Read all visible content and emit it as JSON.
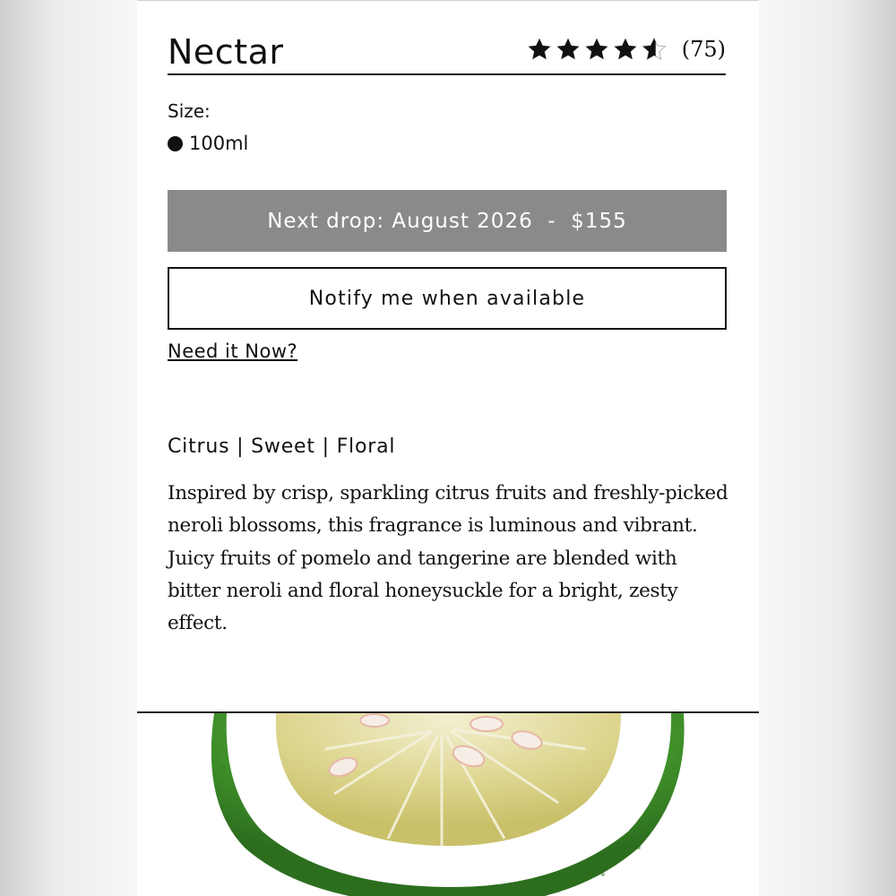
{
  "product": {
    "title": "Nectar",
    "rating": 4.5,
    "review_count": "(75)"
  },
  "size": {
    "label": "Size:",
    "selected": "100ml"
  },
  "actions": {
    "drop_label": "Next drop: August 2026  -  $155",
    "notify_label": "Notify me when available",
    "need_it_now": "Need it Now?"
  },
  "details": {
    "notes": "Citrus | Sweet | Floral",
    "description": "Inspired by crisp, sparkling citrus fruits and freshly-picked neroli blossoms, this fragrance is luminous and vibrant. Juicy fruits of pomelo and tangerine are blended with bitter neroli and floral honeysuckle for a bright, zesty effect."
  },
  "colors": {
    "drop_button_bg": "#8a8a8a",
    "text": "#111111",
    "fruit_rind": "#3f8f2a",
    "fruit_pith": "#ffffff",
    "fruit_flesh": "#d9d38c"
  },
  "icons": {
    "star": "star-icon",
    "half_star": "star-half-icon",
    "radio": "radio-selected-icon"
  }
}
